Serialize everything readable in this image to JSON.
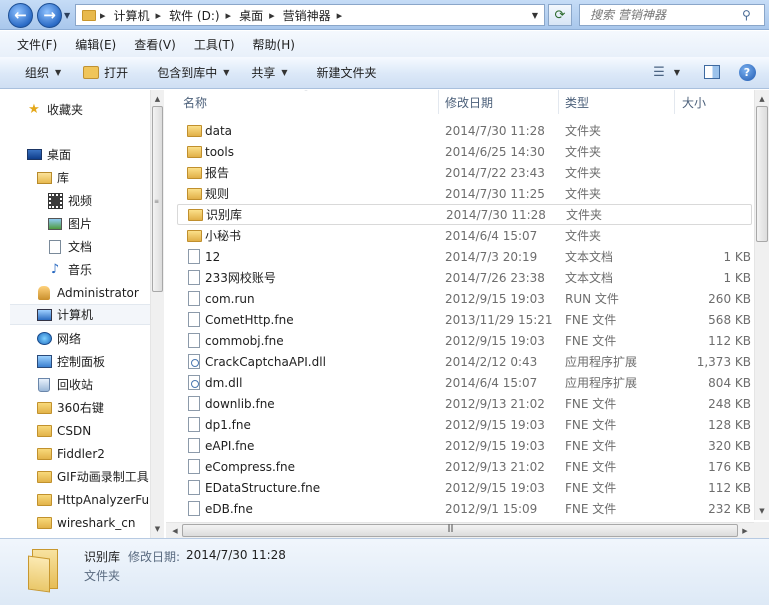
{
  "address": {
    "crumbs": [
      "计算机",
      "软件 (D:)",
      "桌面",
      "营销神器"
    ],
    "search_placeholder": "搜索 营销神器"
  },
  "menu": [
    "文件(F)",
    "编辑(E)",
    "查看(V)",
    "工具(T)",
    "帮助(H)"
  ],
  "toolbar": {
    "organize": "组织",
    "open": "打开",
    "include_library": "包含到库中",
    "share": "共享",
    "new_folder": "新建文件夹"
  },
  "nav": [
    {
      "label": "收藏夹",
      "icon": "star-icon"
    },
    {
      "label": "桌面",
      "icon": "desktop-icon"
    },
    {
      "label": "库",
      "icon": "library-icon"
    },
    {
      "label": "视频",
      "icon": "video-icon"
    },
    {
      "label": "图片",
      "icon": "picture-icon"
    },
    {
      "label": "文档",
      "icon": "document-icon"
    },
    {
      "label": "音乐",
      "icon": "music-icon"
    },
    {
      "label": "Administrator",
      "icon": "user-folder-icon"
    },
    {
      "label": "计算机",
      "icon": "computer-icon"
    },
    {
      "label": "网络",
      "icon": "network-icon"
    },
    {
      "label": "控制面板",
      "icon": "control-panel-icon"
    },
    {
      "label": "回收站",
      "icon": "recycle-bin-icon"
    },
    {
      "label": "360右键",
      "icon": "folder-icon"
    },
    {
      "label": "CSDN",
      "icon": "folder-icon"
    },
    {
      "label": "Fiddler2",
      "icon": "folder-icon"
    },
    {
      "label": "GIF动画录制工具",
      "icon": "folder-icon"
    },
    {
      "label": "HttpAnalyzerFul",
      "icon": "folder-icon"
    },
    {
      "label": "wireshark_cn",
      "icon": "folder-icon"
    }
  ],
  "columns": {
    "name": "名称",
    "date": "修改日期",
    "type": "类型",
    "size": "大小"
  },
  "files": [
    {
      "name": "data",
      "date": "2014/7/30 11:28",
      "type": "文件夹",
      "size": "",
      "kind": "folder"
    },
    {
      "name": "tools",
      "date": "2014/6/25 14:30",
      "type": "文件夹",
      "size": "",
      "kind": "folder"
    },
    {
      "name": "报告",
      "date": "2014/7/22 23:43",
      "type": "文件夹",
      "size": "",
      "kind": "folder"
    },
    {
      "name": "规则",
      "date": "2014/7/30 11:25",
      "type": "文件夹",
      "size": "",
      "kind": "folder"
    },
    {
      "name": "识别库",
      "date": "2014/7/30 11:28",
      "type": "文件夹",
      "size": "",
      "kind": "folder"
    },
    {
      "name": "小秘书",
      "date": "2014/6/4 15:07",
      "type": "文件夹",
      "size": "",
      "kind": "folder"
    },
    {
      "name": "12",
      "date": "2014/7/3 20:19",
      "type": "文本文档",
      "size": "1 KB",
      "kind": "file"
    },
    {
      "name": "233网校账号",
      "date": "2014/7/26 23:38",
      "type": "文本文档",
      "size": "1 KB",
      "kind": "file"
    },
    {
      "name": "com.run",
      "date": "2012/9/15 19:03",
      "type": "RUN 文件",
      "size": "260 KB",
      "kind": "file"
    },
    {
      "name": "CometHttp.fne",
      "date": "2013/11/29 15:21",
      "type": "FNE 文件",
      "size": "568 KB",
      "kind": "file"
    },
    {
      "name": "commobj.fne",
      "date": "2012/9/15 19:03",
      "type": "FNE 文件",
      "size": "112 KB",
      "kind": "file"
    },
    {
      "name": "CrackCaptchaAPI.dll",
      "date": "2014/2/12 0:43",
      "type": "应用程序扩展",
      "size": "1,373 KB",
      "kind": "dll"
    },
    {
      "name": "dm.dll",
      "date": "2014/6/4 15:07",
      "type": "应用程序扩展",
      "size": "804 KB",
      "kind": "dll"
    },
    {
      "name": "downlib.fne",
      "date": "2012/9/13 21:02",
      "type": "FNE 文件",
      "size": "248 KB",
      "kind": "file"
    },
    {
      "name": "dp1.fne",
      "date": "2012/9/15 19:03",
      "type": "FNE 文件",
      "size": "128 KB",
      "kind": "file"
    },
    {
      "name": "eAPI.fne",
      "date": "2012/9/15 19:03",
      "type": "FNE 文件",
      "size": "320 KB",
      "kind": "file"
    },
    {
      "name": "eCompress.fne",
      "date": "2012/9/13 21:02",
      "type": "FNE 文件",
      "size": "176 KB",
      "kind": "file"
    },
    {
      "name": "EDataStructure.fne",
      "date": "2012/9/15 19:03",
      "type": "FNE 文件",
      "size": "112 KB",
      "kind": "file"
    },
    {
      "name": "eDB.fne",
      "date": "2012/9/1 15:09",
      "type": "FNE 文件",
      "size": "232 KB",
      "kind": "file"
    }
  ],
  "details": {
    "name": "识别库",
    "date_label": "修改日期:",
    "date": "2014/7/30 11:28",
    "type": "文件夹"
  }
}
